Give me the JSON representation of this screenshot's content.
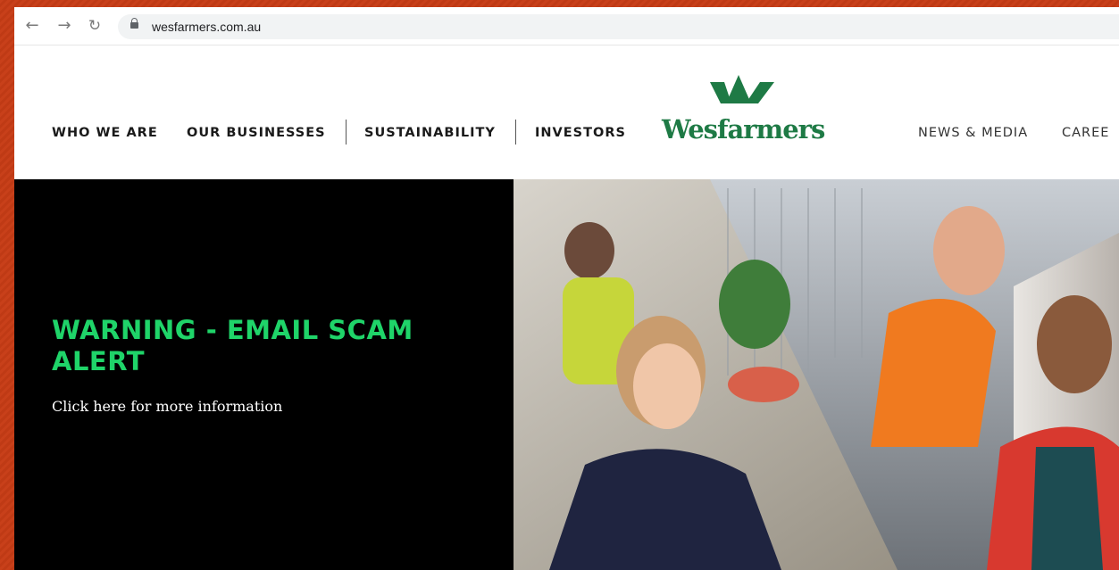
{
  "browser": {
    "back_icon": "arrow-left-icon",
    "forward_icon": "arrow-right-icon",
    "reload_icon": "reload-icon",
    "url": "wesfarmers.com.au"
  },
  "header": {
    "nav_left": [
      "WHO WE ARE",
      "OUR BUSINESSES",
      "SUSTAINABILITY",
      "INVESTORS"
    ],
    "logo_text": "Wesfarmers",
    "nav_right": [
      "NEWS & MEDIA",
      "CAREE"
    ]
  },
  "hero": {
    "alert_title": "WARNING - EMAIL SCAM ALERT",
    "alert_link": "Click here for more information"
  },
  "colors": {
    "brand_green": "#1e7a45",
    "alert_green": "#1fd469",
    "hero_bg": "#000000"
  }
}
